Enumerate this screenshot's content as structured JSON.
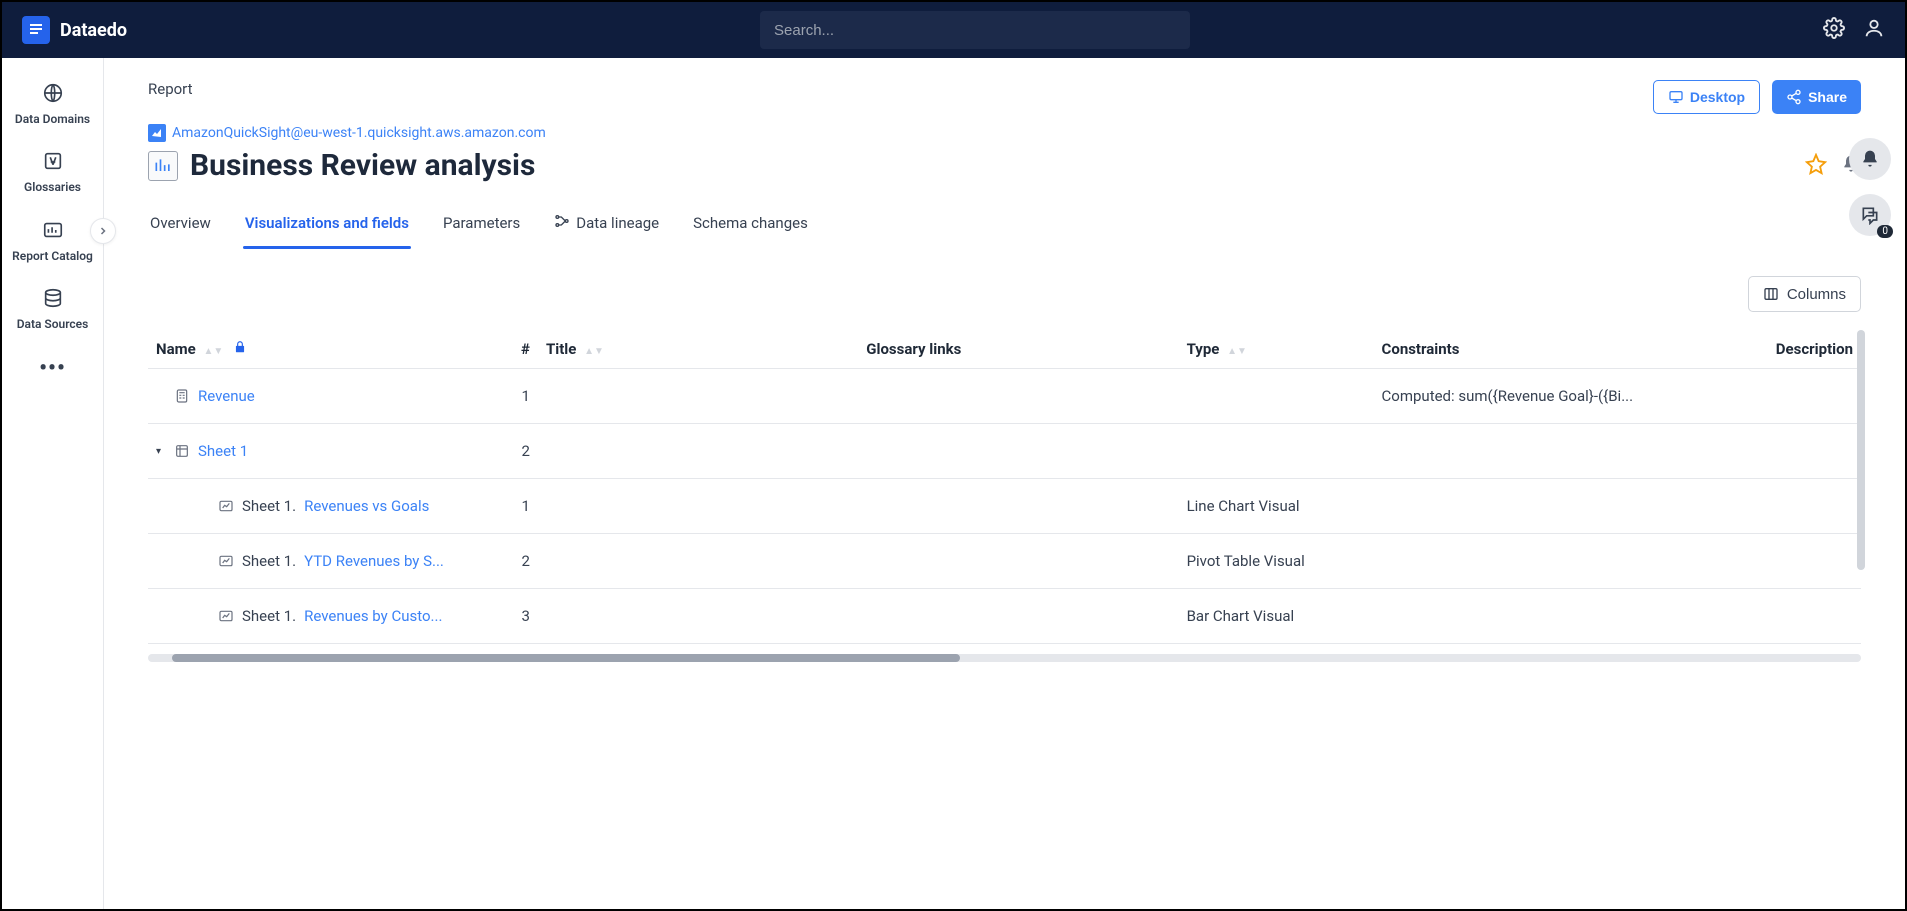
{
  "app": {
    "name": "Dataedo"
  },
  "search": {
    "placeholder": "Search..."
  },
  "sidebar": {
    "items": [
      {
        "label": "Data Domains"
      },
      {
        "label": "Glossaries"
      },
      {
        "label": "Report Catalog"
      },
      {
        "label": "Data Sources"
      }
    ],
    "more": "•••"
  },
  "header": {
    "page_type": "Report",
    "breadcrumb": "AmazonQuickSight@eu-west-1.quicksight.aws.amazon.com",
    "title": "Business Review analysis",
    "actions": {
      "desktop": "Desktop",
      "share": "Share"
    }
  },
  "tabs": [
    {
      "label": "Overview",
      "active": false
    },
    {
      "label": "Visualizations and fields",
      "active": true
    },
    {
      "label": "Parameters",
      "active": false
    },
    {
      "label": "Data lineage",
      "active": false,
      "icon": true
    },
    {
      "label": "Schema changes",
      "active": false
    }
  ],
  "table_actions": {
    "columns": "Columns"
  },
  "columns": {
    "name": "Name",
    "num": "#",
    "title": "Title",
    "glossary": "Glossary links",
    "type": "Type",
    "constraints": "Constraints",
    "description": "Description"
  },
  "rows": [
    {
      "indent": 0,
      "toggle": "",
      "icon": "calc",
      "link": "Revenue",
      "prefix": "",
      "num": "1",
      "title": "",
      "glossary": "",
      "type": "",
      "constraints": "Computed: sum({Revenue Goal}-({Bi...",
      "desc": ""
    },
    {
      "indent": 0,
      "toggle": "▾",
      "icon": "sheet",
      "link": "Sheet 1",
      "prefix": "",
      "num": "2",
      "title": "",
      "glossary": "",
      "type": "",
      "constraints": "",
      "desc": ""
    },
    {
      "indent": 2,
      "toggle": "",
      "icon": "viz",
      "link": "Revenues vs Goals",
      "prefix": "Sheet 1. ",
      "num": "1",
      "title": "",
      "glossary": "",
      "type": "Line Chart Visual",
      "constraints": "",
      "desc": ""
    },
    {
      "indent": 2,
      "toggle": "",
      "icon": "viz",
      "link": "YTD Revenues by S...",
      "prefix": "Sheet 1. ",
      "num": "2",
      "title": "",
      "glossary": "",
      "type": "Pivot Table Visual",
      "constraints": "",
      "desc": ""
    },
    {
      "indent": 2,
      "toggle": "",
      "icon": "viz",
      "link": "Revenues by Custo...",
      "prefix": "Sheet 1. ",
      "num": "3",
      "title": "",
      "glossary": "",
      "type": "Bar Chart Visual",
      "constraints": "",
      "desc": ""
    }
  ],
  "float": {
    "badge": "0"
  }
}
